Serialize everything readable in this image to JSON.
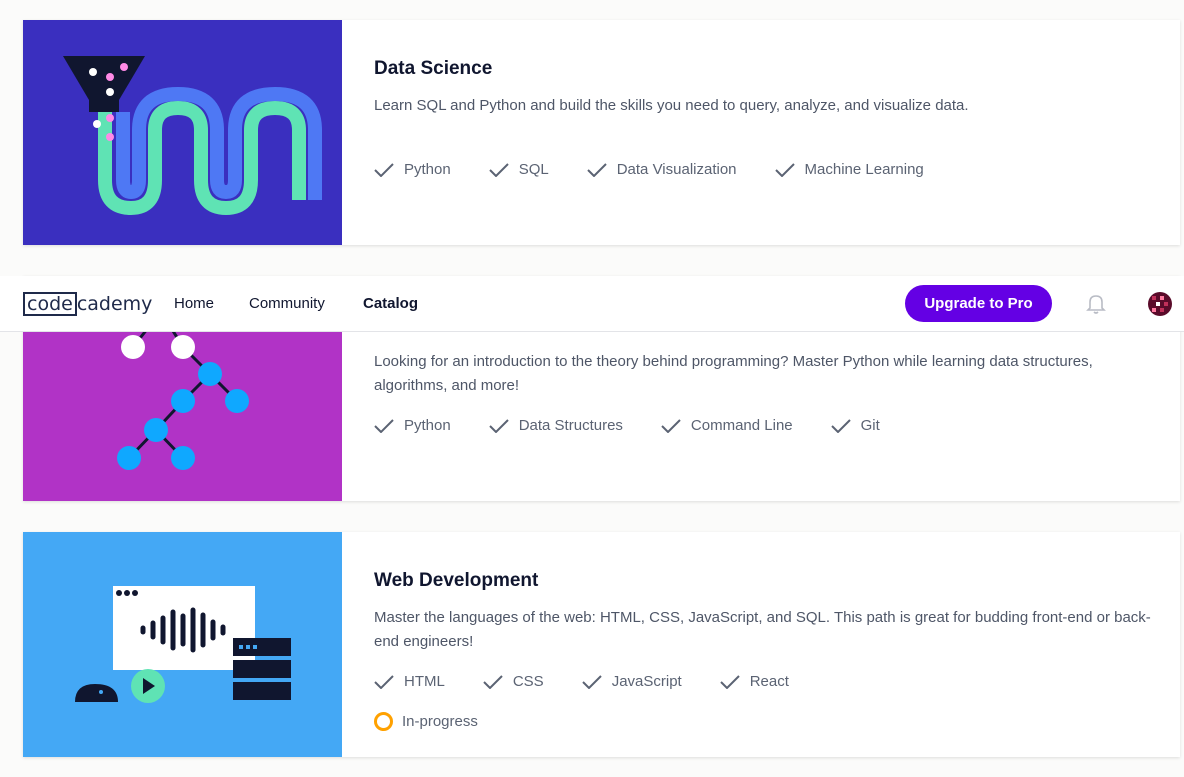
{
  "nav": {
    "logo_box": "code",
    "logo_rest": "cademy",
    "links": [
      "Home",
      "Community",
      "Catalog"
    ],
    "active": "Catalog",
    "upgrade_label": "Upgrade to Pro",
    "accent": "#6400e4"
  },
  "cards": [
    {
      "title": "Data Science",
      "description": "Learn SQL and Python and build the skills you need to query, analyze, and visualize data.",
      "skills": [
        "Python",
        "SQL",
        "Data Visualization",
        "Machine Learning"
      ],
      "thumb_color": "#3a2fbf"
    },
    {
      "title": "",
      "description": "Looking for an introduction to the theory behind programming? Master Python while learning data structures, algorithms, and more!",
      "skills": [
        "Python",
        "Data Structures",
        "Command Line",
        "Git"
      ],
      "thumb_color": "#b133c6"
    },
    {
      "title": "Web Development",
      "description": "Master the languages of the web: HTML, CSS, JavaScript, and SQL. This path is great for budding front-end or back-end engineers!",
      "skills": [
        "HTML",
        "CSS",
        "JavaScript",
        "React"
      ],
      "status": "In-progress",
      "thumb_color": "#44a8f5"
    }
  ],
  "icons": [
    "check-icon",
    "bell-icon",
    "avatar",
    "progress-ring-icon"
  ]
}
